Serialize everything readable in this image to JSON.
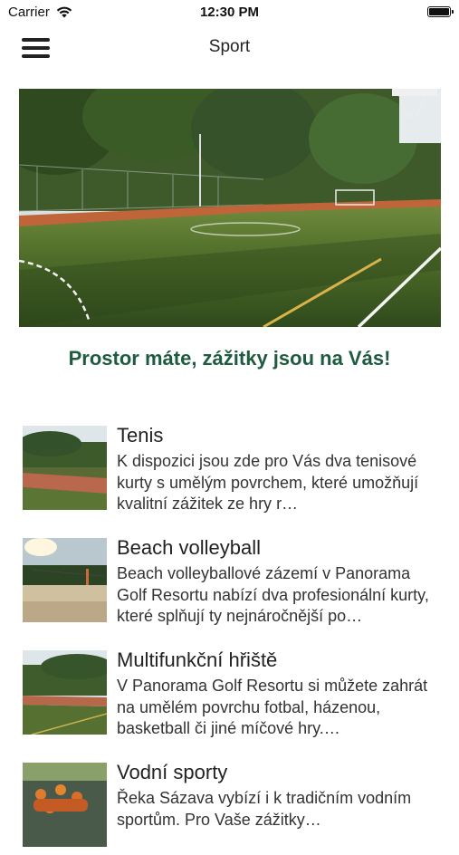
{
  "status": {
    "carrier": "Carrier",
    "time": "12:30 PM"
  },
  "nav": {
    "title": "Sport"
  },
  "tagline": "Prostor máte, zážitky jsou na Vás!",
  "items": [
    {
      "title": "Tenis",
      "description": "K dispozici jsou zde pro Vás dva tenisové kurty s umělým povrchem, které umožňují kvalitní zážitek ze hry r…",
      "thumb": "tennis-court"
    },
    {
      "title": "Beach volleyball",
      "description": "Beach volleyballové zázemí v Panorama Golf Resortu nabízí dva profesionální kurty, které splňují ty nejnáročnější po…",
      "thumb": "beach-volleyball-court"
    },
    {
      "title": "Multifunkční hřiště",
      "description": "V Panorama Golf Resortu si můžete zahrát na umělém povrchu fotbal, házenou, basketball či jiné míčové hry.…",
      "thumb": "multifunction-court"
    },
    {
      "title": "Vodní sporty",
      "description": "Řeka Sázava vybízí i k tradičním vodním sportům. Pro Vaše zážitky…",
      "thumb": "rafting"
    }
  ]
}
